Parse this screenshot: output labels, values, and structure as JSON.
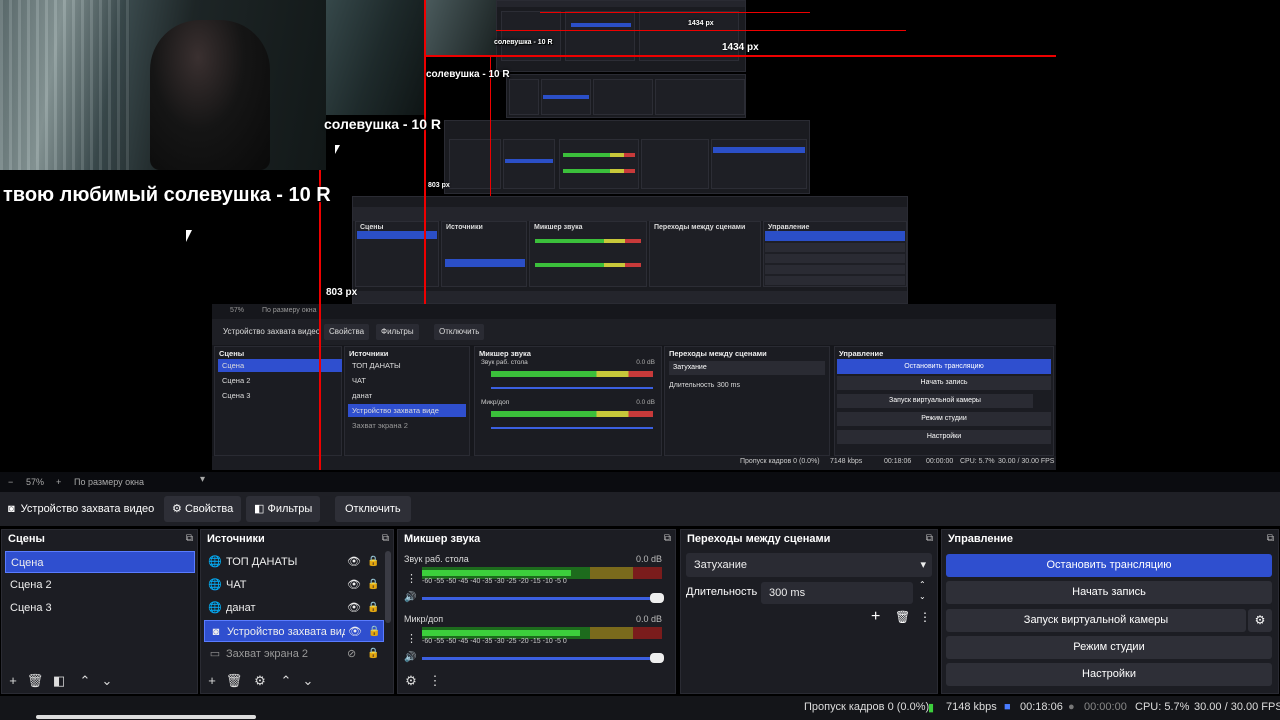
{
  "preview": {
    "overlay_big": "твою любимый солевушка - 10 R",
    "overlay_mid": "солевушка - 10 R",
    "overlay_small": "солевушка - 10 R",
    "overlay_tiny": "солевушка - 10 R",
    "px_1434_a": "1434 px",
    "px_1434_b": "1434 px",
    "px_803_a": "803 px",
    "px_803_b": "803 px",
    "nested": {
      "zoom": "57%",
      "fit": "По размеру окна",
      "source_name": "Устройство захвата видео",
      "props": "Свойства",
      "filters": "Фильтры",
      "disable": "Отключить",
      "scenes_title": "Сцены",
      "scenes": [
        "Сцена",
        "Сцена 2",
        "Сцена 3"
      ],
      "sources_title": "Источники",
      "sources": [
        "ТОП ДАНАТЫ",
        "ЧАТ",
        "данат",
        "Устройство захвата виде",
        "Захват экрана 2"
      ],
      "mixer_title": "Микшер звука",
      "ch1": "Звук раб. стола",
      "ch2": "Микр/доп",
      "db": "0.0 dB",
      "transitions_title": "Переходы между сценами",
      "transition": "Затухание",
      "duration_label": "Длительность",
      "duration": "300 ms",
      "controls_title": "Управление",
      "ctrl": [
        "Остановить трансляцию",
        "Начать запись",
        "Запуск виртуальной камеры",
        "Режим студии",
        "Настройки"
      ],
      "status_dropped": "Пропуск кадров 0 (0.0%)",
      "status_kbps": "7148 kbps",
      "status_time": "00:18:06",
      "status_rec": "00:00:00",
      "status_cpu": "CPU: 5.7%",
      "status_fps": "30.00 / 30.00 FPS"
    }
  },
  "zoombar": {
    "minus": "−",
    "zoom": "57%",
    "plus": "+",
    "fit": "По размеру окна"
  },
  "source_bar": {
    "name": "Устройство захвата видео",
    "properties": "Свойства",
    "filters": "Фильтры",
    "disable": "Отключить"
  },
  "scenes": {
    "title": "Сцены",
    "items": [
      "Сцена",
      "Сцена 2",
      "Сцена 3"
    ]
  },
  "sources": {
    "title": "Источники",
    "items": [
      {
        "label": "ТОП ДАНАТЫ",
        "icon": "globe-icon"
      },
      {
        "label": "ЧАТ",
        "icon": "globe-icon"
      },
      {
        "label": "данат",
        "icon": "globe-icon"
      },
      {
        "label": "Устройство захвата виде",
        "icon": "camera-icon"
      },
      {
        "label": "Захват экрана 2",
        "icon": "monitor-icon"
      }
    ]
  },
  "mixer": {
    "title": "Микшер звука",
    "channels": [
      {
        "name": "Звук раб. стола",
        "db": "0.0 dB",
        "level": 0.62
      },
      {
        "name": "Микр/доп",
        "db": "0.0 dB",
        "level": 0.66
      }
    ],
    "scale": "-60 -55 -50 -45 -40 -35 -30 -25 -20 -15 -10 -5 0"
  },
  "transitions": {
    "title": "Переходы между сценами",
    "type": "Затухание",
    "duration_label": "Длительность",
    "duration": "300 ms"
  },
  "controls": {
    "title": "Управление",
    "stop_stream": "Остановить трансляцию",
    "start_record": "Начать запись",
    "virtual_cam": "Запуск виртуальной камеры",
    "studio_mode": "Режим студии",
    "settings": "Настройки"
  },
  "status": {
    "dropped": "Пропуск кадров 0 (0.0%)",
    "kbps": "7148 kbps",
    "stream_time": "00:18:06",
    "rec_time": "00:00:00",
    "cpu": "CPU: 5.7%",
    "fps": "30.00 / 30.00 FPS"
  },
  "colors": {
    "accent": "#2f4fcf",
    "background": "#1c1d23",
    "red_guide": "#e00000"
  }
}
